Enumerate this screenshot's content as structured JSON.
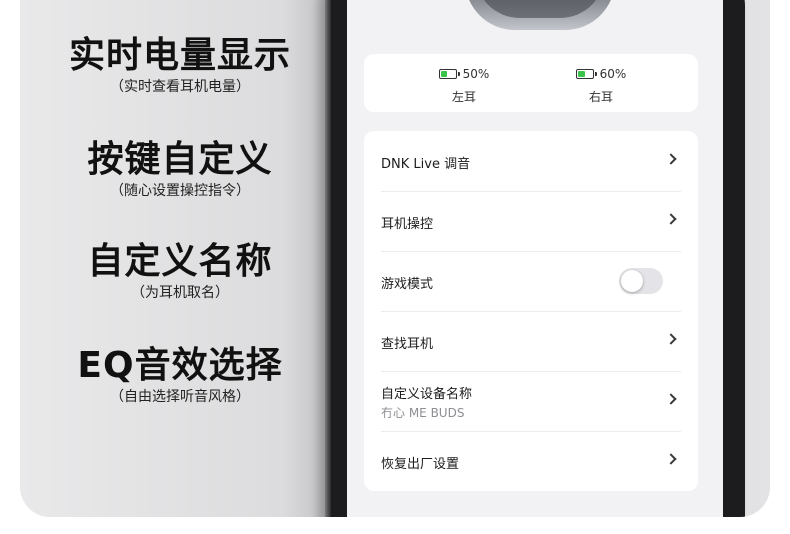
{
  "features": [
    {
      "title": "实时电量显示",
      "subtitle": "（实时查看耳机电量）"
    },
    {
      "title": "按键自定义",
      "subtitle": "（随心设置操控指令）"
    },
    {
      "title": "自定义名称",
      "subtitle": "（为耳机取名）"
    },
    {
      "title": "EQ音效选择",
      "subtitle": "（自由选择听音风格）"
    }
  ],
  "battery": {
    "left": {
      "percent": "50%",
      "label": "左耳",
      "level": 0.5,
      "color": "#3ac34a"
    },
    "right": {
      "percent": "60%",
      "label": "右耳",
      "level": 0.6,
      "color": "#3ac34a"
    }
  },
  "menu": [
    {
      "name": "DNK Live 调音",
      "type": "chevron",
      "icon": "chevron-right-icon"
    },
    {
      "name": "耳机操控",
      "type": "chevron",
      "icon": "chevron-right-icon"
    },
    {
      "name": "游戏模式",
      "type": "toggle",
      "toggle_on": false
    },
    {
      "name": "查找耳机",
      "type": "chevron",
      "icon": "chevron-right-icon"
    },
    {
      "name": "自定义设备名称",
      "value": "冇心 ME BUDS",
      "type": "chevron",
      "icon": "chevron-right-icon"
    },
    {
      "name": "恢复出厂设置",
      "type": "chevron",
      "icon": "chevron-right-icon"
    }
  ]
}
